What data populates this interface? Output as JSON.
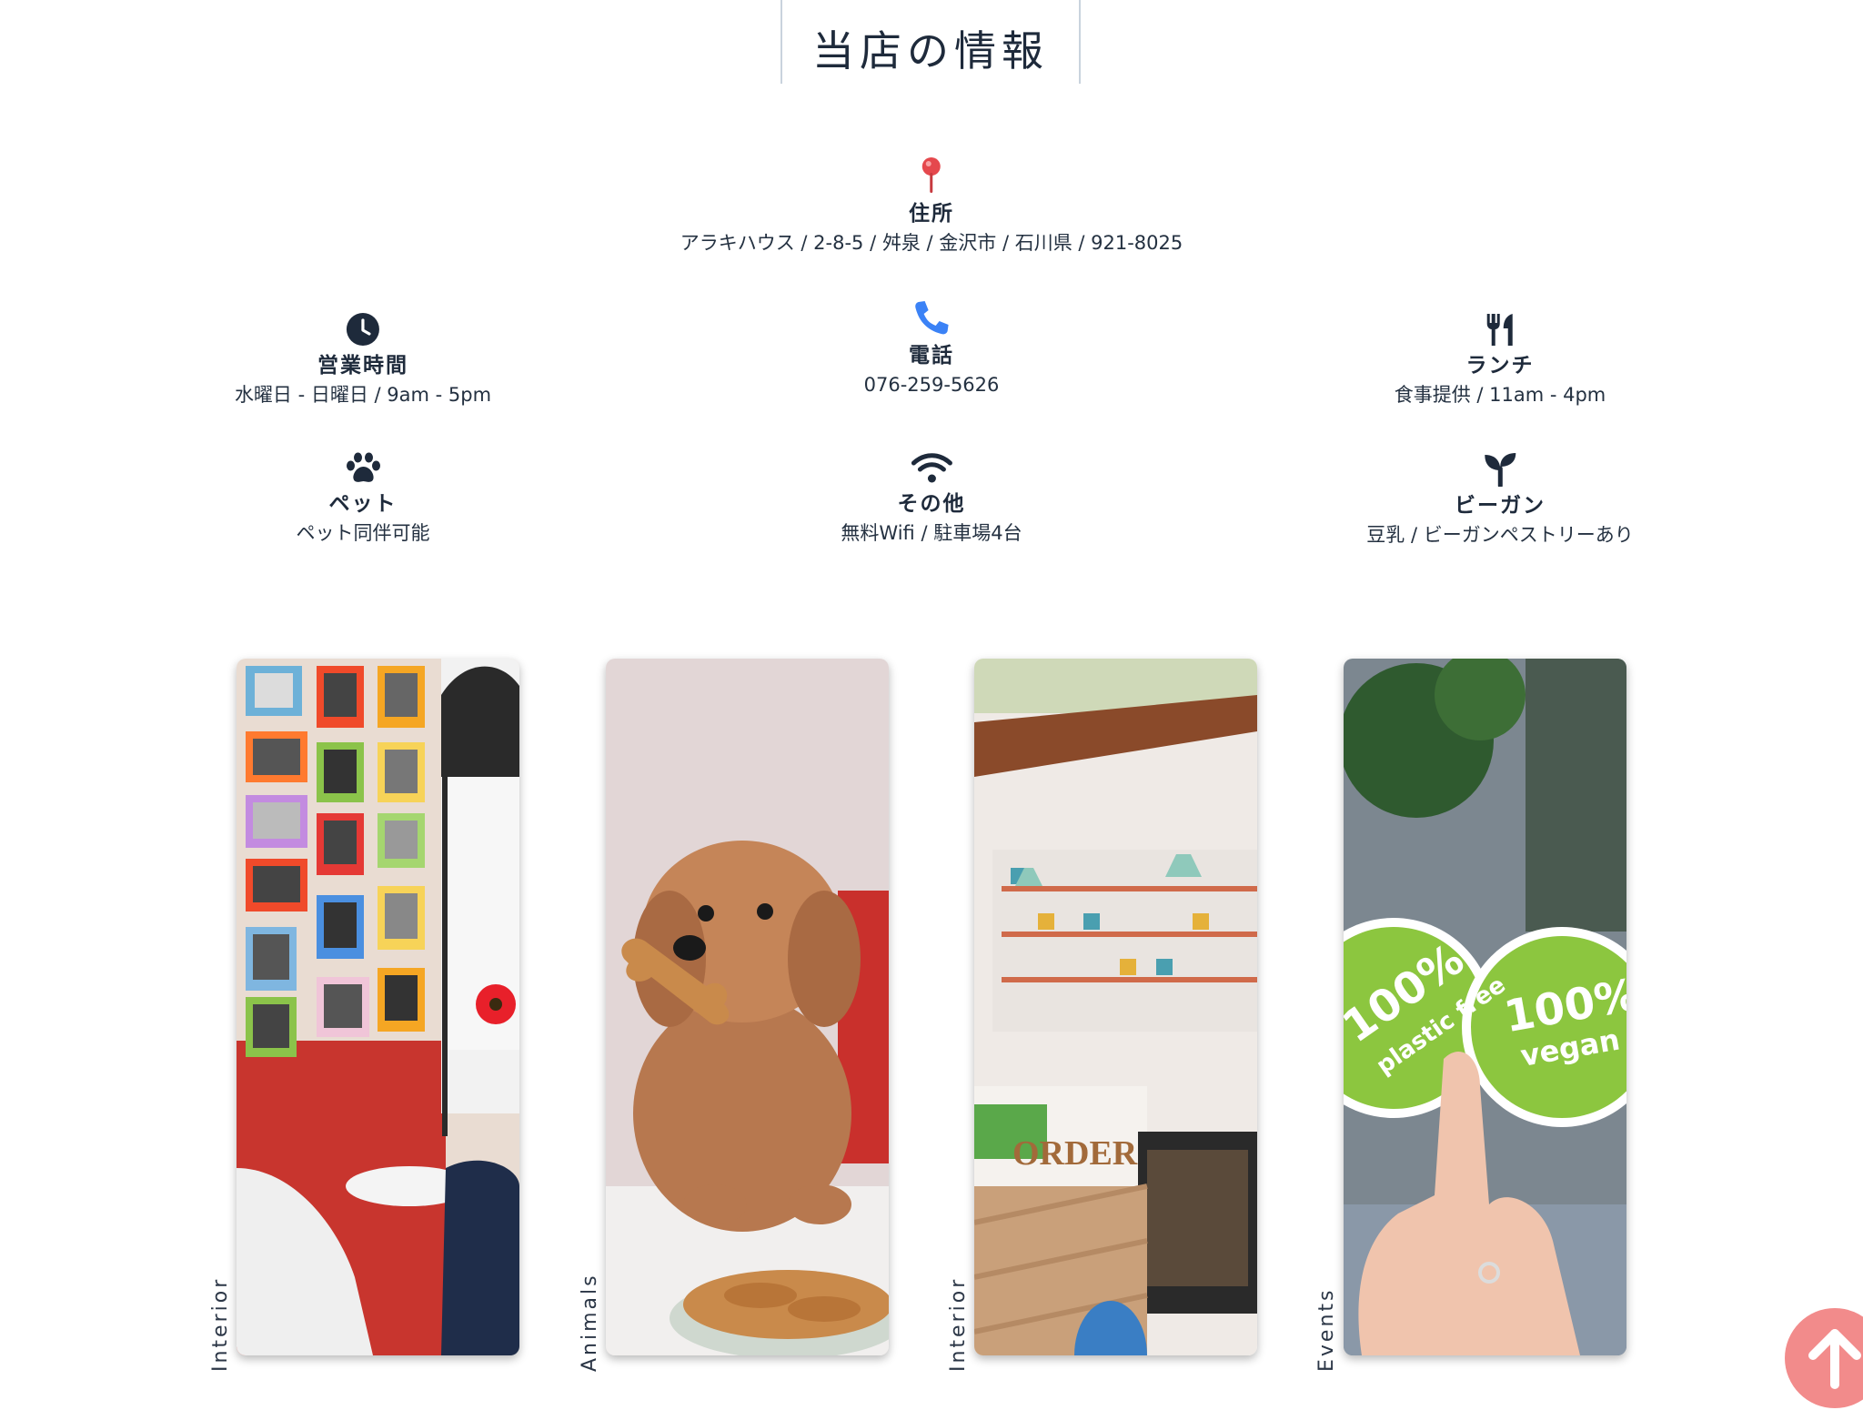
{
  "section_title": "当店の情報",
  "info": {
    "address": {
      "label": "住所",
      "value": "アラキハウス / 2-8-5 / 舛泉 / 金沢市 / 石川県 / 921-8025",
      "icon": "map-pin-icon",
      "color": "#e5484d"
    },
    "hours": {
      "label": "営業時間",
      "value": "水曜日 - 日曜日 / 9am - 5pm",
      "icon": "clock-icon"
    },
    "phone": {
      "label": "電話",
      "value": "076-259-5626",
      "icon": "phone-icon",
      "color": "#3b82f6"
    },
    "lunch": {
      "label": "ランチ",
      "value": "食事提供 / 11am - 4pm",
      "icon": "utensils-icon"
    },
    "pets": {
      "label": "ペット",
      "value": "ペット同伴可能",
      "icon": "paw-icon"
    },
    "other": {
      "label": "その他",
      "value": "無料Wifi / 駐車場4台",
      "icon": "wifi-icon"
    },
    "vegan": {
      "label": "ビーガン",
      "value": "豆乳 / ビーガンペストリーあり",
      "icon": "seedling-icon"
    }
  },
  "gallery": [
    {
      "label": "Interior",
      "photo": "photo-wall-cafe-interior"
    },
    {
      "label": "Animals",
      "photo": "dog-with-biscuit"
    },
    {
      "label": "Interior",
      "photo": "cafe-order-counter"
    },
    {
      "label": "Events",
      "photo": "vegan-plastic-free-stickers"
    }
  ],
  "gallery_text": {
    "order_sign": "ORDER",
    "sticker_left_1": "100%",
    "sticker_left_2": "plastic free",
    "sticker_right_1": "100%",
    "sticker_right_2": "vegan"
  },
  "back_to_top": {
    "icon": "arrow-up-icon",
    "color": "#f28b8b"
  }
}
